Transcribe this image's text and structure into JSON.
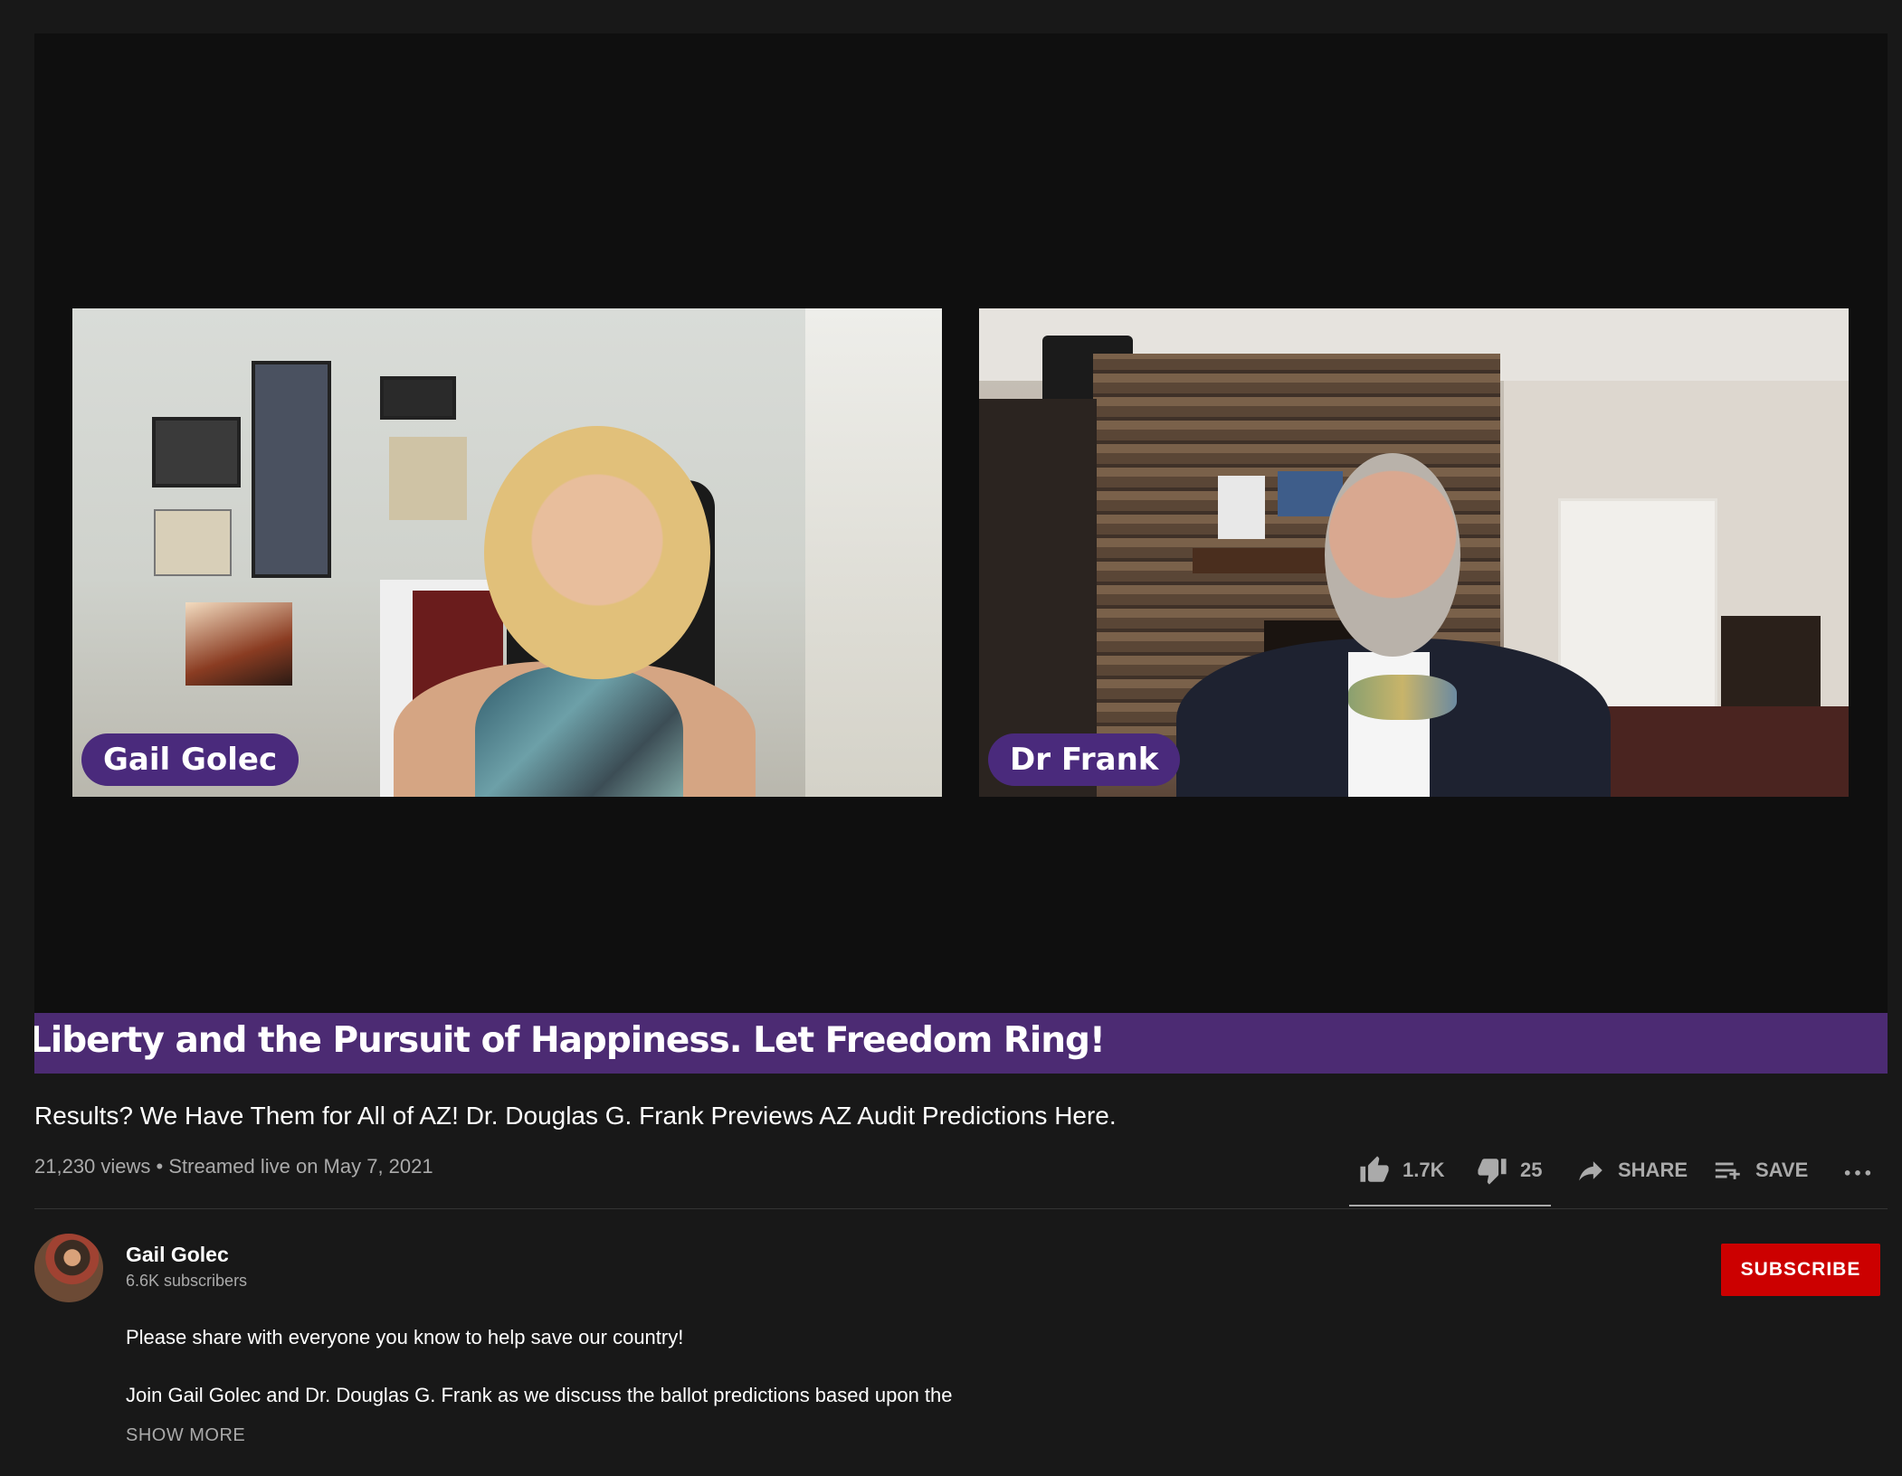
{
  "player": {
    "participants": [
      {
        "name": "Gail Golec"
      },
      {
        "name": "Dr Frank"
      }
    ],
    "banner_text": "Liberty and the Pursuit of Happiness. Let Freedom Ring!"
  },
  "video": {
    "title": "Results? We Have Them for All of AZ! Dr. Douglas G. Frank Previews AZ Audit Predictions Here.",
    "meta": "21,230 views • Streamed live on May 7, 2021"
  },
  "actions": {
    "like_count": "1.7K",
    "dislike_count": "25",
    "share_label": "SHARE",
    "save_label": "SAVE",
    "more_icon": "more-horizontal-icon"
  },
  "channel": {
    "name": "Gail Golec",
    "subscribers": "6.6K subscribers",
    "subscribe_label": "SUBSCRIBE"
  },
  "description": {
    "line1": "Please share with everyone you know to help save our country!",
    "line2": "Join Gail Golec and Dr. Douglas G. Frank as we discuss the ballot predictions based upon the",
    "show_more": "SHOW MORE"
  },
  "colors": {
    "background": "#181818",
    "player": "#0f0f0f",
    "banner": "#4c2b73",
    "name_tag": "#4a2a7c",
    "subscribe": "#cc0000"
  }
}
